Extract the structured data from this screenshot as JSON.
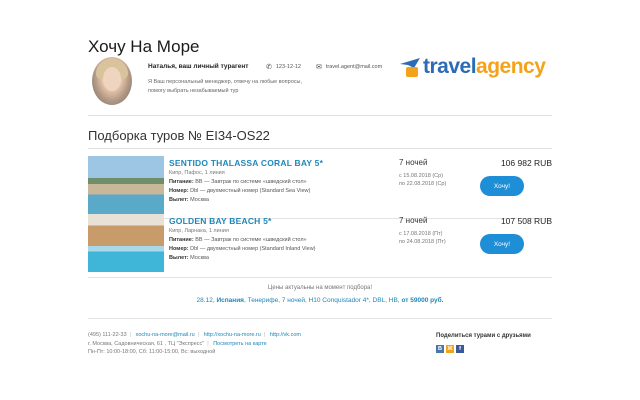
{
  "header": {
    "title": "Хочу На Море",
    "agent_name": "Наталья, ваш личный турагент",
    "agent_text": "Я Ваш персональный менеджер, отвечу на любые вопросы, помогу выбрать незабываемый тур",
    "phone": "123-12-12",
    "email": "travel.agent@mail.com",
    "logo_travel": "travel",
    "logo_agency": "agency"
  },
  "selection": {
    "title": "Подборка туров № EI34-OS22"
  },
  "tours": [
    {
      "name": "SENTIDO THALASSA CORAL BAY 5*",
      "place": "Кипр, Пафос, 1 линия",
      "meal_label": "Питание:",
      "meal": "BB — Завтрак по системе «шведский стол»",
      "room_label": "Номер:",
      "room": "Dbl — двухместный номер (Standard Sea View)",
      "departure_label": "Вылет:",
      "departure": "Москва",
      "nights": "7 ночей",
      "date_from": "с 15.08.2018 (Ср)",
      "date_to": "по 22.08.2018 (Ср)",
      "price": "106 982 RUB",
      "button": "Хочу!"
    },
    {
      "name": "GOLDEN BAY BEACH 5*",
      "place": "Кипр, Ларнака, 1 линия",
      "meal_label": "Питание:",
      "meal": "BB — Завтрак по системе «шведский стол»",
      "room_label": "Номер:",
      "room": "Dbl — двухместный номер (Standard Inland View)",
      "departure_label": "Вылет:",
      "departure": "Москва",
      "nights": "7 ночей",
      "date_from": "с 17.08.2018 (Пт)",
      "date_to": "по 24.08.2018 (Пт)",
      "price": "107 508 RUB",
      "button": "Хочу!"
    }
  ],
  "notes": {
    "prices_actual": "Цены актуальны на момент подбора!",
    "offer_prefix": "28.12, ",
    "offer_country": "Испания",
    "offer_middle": ", Тенерифе, 7 ночей, H10 Conquistador 4*, DBL, HB, ",
    "offer_price": "от 59000 руб."
  },
  "footer": {
    "phone": "(495) 111-22-33",
    "email": "xochu-na-more@mail.ru",
    "site": "http://xochu-na-more.ru",
    "vk": "http://vk.com",
    "address": "г. Москва, Садовническая, 61 , ТЦ \"Экспресс\"",
    "map_link": "Посмотреть на карте",
    "hours": "Пн-Пт: 10:00-18:00, Сб: 11:00-15:00, Вс: выходной"
  },
  "share": {
    "title": "Поделиться турами с друзьями",
    "icons": [
      "В",
      "Ж",
      "f"
    ],
    "colors": [
      "#4a76a8",
      "#f5a21b",
      "#3b5998"
    ]
  }
}
